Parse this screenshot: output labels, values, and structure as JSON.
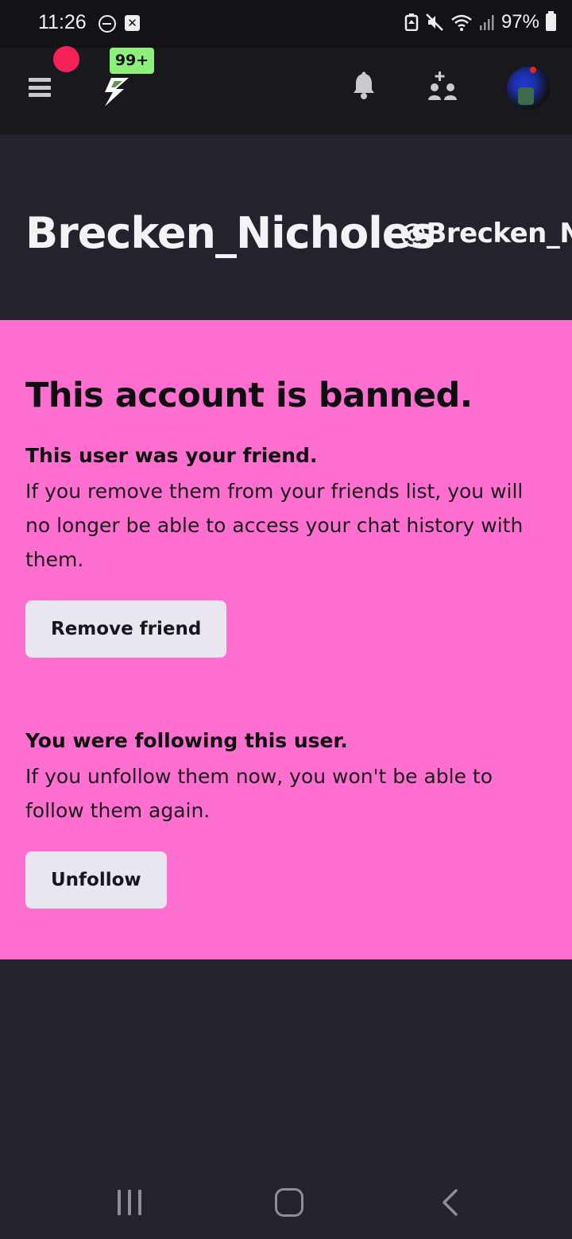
{
  "status_bar": {
    "time": "11:26",
    "battery": "97%"
  },
  "top_bar": {
    "notification_badge": "99+"
  },
  "profile": {
    "display_name": "Brecken_Nicholes",
    "handle": "@Brecken_N"
  },
  "banned_panel": {
    "title": "This account is banned.",
    "friend_heading": "This user was your friend.",
    "friend_body": "If you remove them from your friends list, you will no longer be able to access your chat history with them.",
    "remove_friend_label": "Remove friend",
    "follow_heading": "You were following this user.",
    "follow_body": "If you unfollow them now, you won't be able to follow them again.",
    "unfollow_label": "Unfollow"
  },
  "colors": {
    "panel_bg": "#ff6fcf",
    "page_bg": "#23222d",
    "topbar_bg": "#19191d",
    "badge_green": "#8ef07b",
    "notification_red": "#f7215a"
  }
}
